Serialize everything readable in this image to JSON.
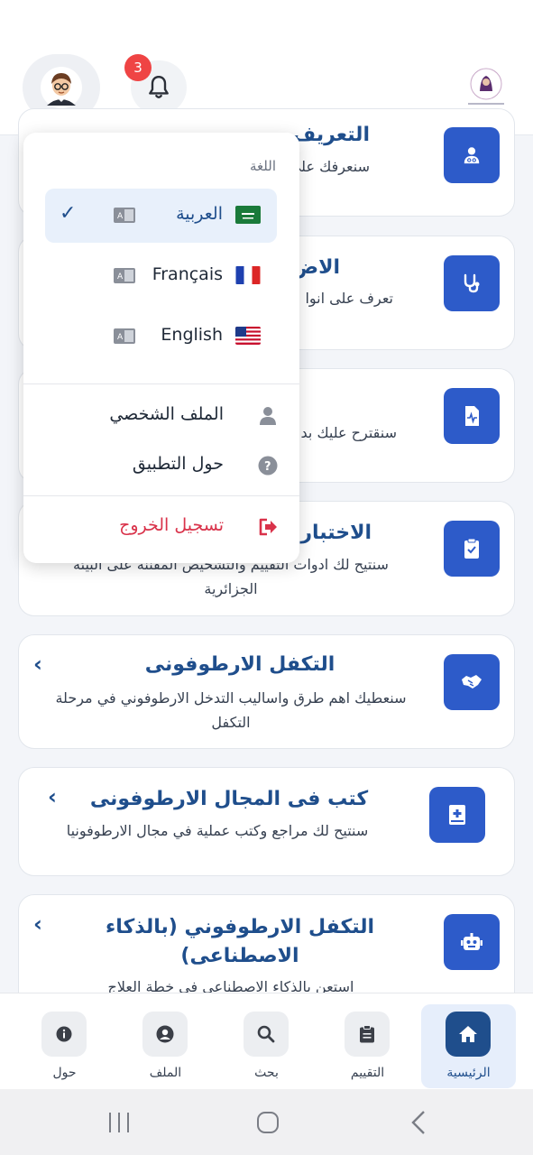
{
  "header": {
    "notification_count": "3"
  },
  "menu": {
    "language_heading": "اللغة",
    "languages": [
      {
        "label": "العربية",
        "flag": "saudi-flag",
        "selected": true
      },
      {
        "label": "Français",
        "flag": "france-flag",
        "selected": false
      },
      {
        "label": "English",
        "flag": "us-flag",
        "selected": false
      }
    ],
    "profile_label": "الملف الشخصي",
    "about_label": "حول التطبيق",
    "logout_label": "تسجيل الخروج"
  },
  "cards": [
    {
      "title": "التعريف",
      "desc": "سنعرفك على تخ",
      "icon": "user-doctor-icon"
    },
    {
      "title": "الاض",
      "desc": "تعرف على انوا",
      "icon": "stethoscope-icon"
    },
    {
      "title": "",
      "desc": "سنقترح عليك بد",
      "icon": "file-waveform-icon"
    },
    {
      "title": "الاختبارا",
      "desc": "سنتيح لك ادوات التقييم والتشخيص المقننة على البيئة الجزائرية",
      "icon": "clipboard-check-icon"
    },
    {
      "title": "التكفل الارطوفونى",
      "desc": "سنعطيك اهم طرق واساليب التدخل الارطوفوني في مرحلة التكفل",
      "icon": "handshake-icon"
    },
    {
      "title": "كتب فى المجال الارطوفونى",
      "desc": "سنتيح لك مراجع وكتب عملية في مجال الارطوفونيا",
      "icon": "book-medical-icon"
    },
    {
      "title": "التكفل الارطوفوني (بالذكاء الاصطناعى)",
      "desc": "استعن بالذكاء الاصطناعي في خطة العلاج",
      "icon": "robot-icon"
    }
  ],
  "bottom_nav": [
    {
      "label": "حول",
      "icon": "info-icon"
    },
    {
      "label": "الملف",
      "icon": "user-circle-icon"
    },
    {
      "label": "بحث",
      "icon": "search-icon"
    },
    {
      "label": "التقييم",
      "icon": "clipboard-icon"
    },
    {
      "label": "الرئيسية",
      "icon": "home-icon",
      "active": true
    }
  ],
  "colors": {
    "primary": "#1f4e8c",
    "card_icon_bg": "#2d5bc9",
    "logout": "#d9324a",
    "badge": "#ef4444"
  }
}
